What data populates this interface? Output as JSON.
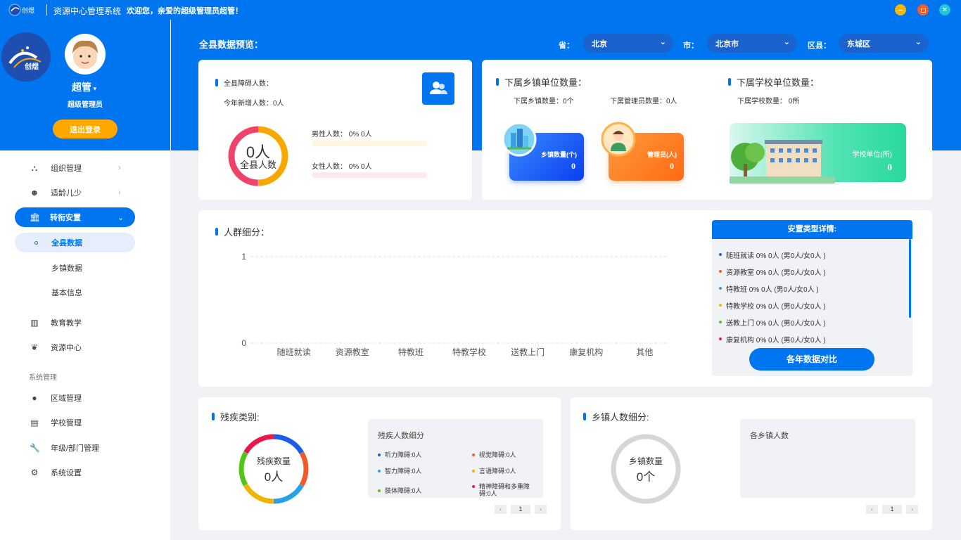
{
  "app": {
    "title": "资源中心管理系统",
    "welcome": "欢迎您，亲爱的超级管理员超管！",
    "logo_text": "创煜"
  },
  "user": {
    "name": "超管",
    "role": "超级管理员",
    "logout": "退出登录"
  },
  "menu": [
    {
      "label": "组织管理",
      "icon": "org-icon"
    },
    {
      "label": "适龄儿少",
      "icon": "child-icon"
    },
    {
      "label": "转衔安置",
      "icon": "bank-icon"
    },
    {
      "label": "全县数据"
    },
    {
      "label": "乡镇数据"
    },
    {
      "label": "基本信息"
    },
    {
      "label": "教育教学",
      "icon": "books-icon"
    },
    {
      "label": "资源中心",
      "icon": "resource-icon"
    },
    {
      "group": "系统管理"
    },
    {
      "label": "区域管理",
      "icon": "region-icon"
    },
    {
      "label": "学校管理",
      "icon": "school-icon"
    },
    {
      "label": "年级/部门管理",
      "icon": "wrench-icon"
    },
    {
      "label": "系统设置",
      "icon": "gear-icon"
    }
  ],
  "page": {
    "title": "全县数据预览："
  },
  "filters": {
    "province_label": "省：",
    "province": "北京",
    "city_label": "市：",
    "city": "北京市",
    "district_label": "区县：",
    "district": "东城区"
  },
  "overview": {
    "total_label": "全县障碍人数：",
    "new_label": "今年新增人数：0人",
    "ring_value": "0人",
    "ring_caption": "全县人数",
    "male": "男性人数：  0%  0人",
    "female": "女性人数：  0%  0人",
    "male_fill": 0,
    "female_fill": 0
  },
  "towns": {
    "title": "下属乡镇单位数量：",
    "town_count": "下属乡镇数量：0个",
    "admin_count": "下属管理员数量：0人",
    "town_card": {
      "label": "乡镇数量(个)",
      "value": "0"
    },
    "admin_card": {
      "label": "管理员(人)",
      "value": "0"
    }
  },
  "schools": {
    "title": "下属学校单位数量：",
    "count": "下属学校数量：  0所",
    "card": {
      "label": "学校单位(所)",
      "value": "0"
    }
  },
  "crowd": {
    "title": "人群细分："
  },
  "chart_data": {
    "type": "bar",
    "categories": [
      "随班就读",
      "资源教室",
      "特教班",
      "特教学校",
      "送教上门",
      "康复机构",
      "其他"
    ],
    "values": [
      0,
      0,
      0,
      0,
      0,
      0,
      0
    ],
    "ylim": [
      0,
      1
    ],
    "yticks": [
      "1",
      "0"
    ],
    "grid": true
  },
  "placement": {
    "title": "安置类型详情:",
    "items": [
      {
        "text": "随班就读 0% 0人 (男0人/女0人 )",
        "color": "#1c5ce8"
      },
      {
        "text": "资源教室 0% 0人 (男0人/女0人 )",
        "color": "#f05a28"
      },
      {
        "text": "特教班 0% 0人 (男0人/女0人 )",
        "color": "#26a2e8"
      },
      {
        "text": "特教学校 0% 0人 (男0人/女0人 )",
        "color": "#f0b400"
      },
      {
        "text": "送教上门 0% 0人 (男0人/女0人 )",
        "color": "#52c41a"
      },
      {
        "text": "康复机构 0% 0人 (男0人/女0人 )",
        "color": "#e8194a"
      }
    ],
    "button": "各年数据对比"
  },
  "disability": {
    "title": "残疾类别:",
    "ring_caption": "残疾数量",
    "ring_value": "0人",
    "panel_title": "残疾人数细分",
    "items": [
      {
        "text": "听力障碍:0人",
        "color": "#1c5ce8"
      },
      {
        "text": "视觉障碍:0人",
        "color": "#f05a28"
      },
      {
        "text": "智力障碍:0人",
        "color": "#26a2e8"
      },
      {
        "text": "言语障碍:0人",
        "color": "#f0b400"
      },
      {
        "text": "肢体障碍:0人",
        "color": "#52c41a"
      },
      {
        "text": "精神障碍和多重障碍:0人",
        "color": "#e8194a"
      }
    ],
    "page": "1"
  },
  "township": {
    "title": "乡镇人数细分:",
    "ring_caption": "乡镇数量",
    "ring_value": "0个",
    "panel_title": "各乡镇人数",
    "page": "1"
  }
}
